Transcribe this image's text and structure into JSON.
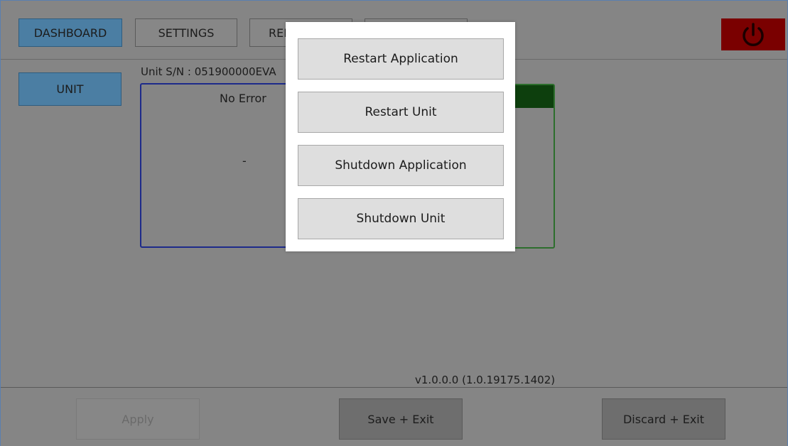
{
  "nav": {
    "tabs": [
      {
        "label": "DASHBOARD",
        "active": true
      },
      {
        "label": "SETTINGS",
        "active": false
      },
      {
        "label": "REF",
        "active": false
      },
      {
        "label": "",
        "active": false
      }
    ]
  },
  "power_icon": "power-icon",
  "sidebar": {
    "unit_label": "UNIT"
  },
  "unit": {
    "serial": "Unit S/N : 051900000EVA"
  },
  "error_panel": {
    "title": "No Error",
    "value": "-"
  },
  "version": "v1.0.0.0 (1.0.19175.1402)",
  "footer": {
    "apply_label": "Apply",
    "save_exit_label": "Save + Exit",
    "discard_exit_label": "Discard + Exit"
  },
  "power_dialog": {
    "options": [
      "Restart Application",
      "Restart Unit",
      "Shutdown Application",
      "Shutdown Unit"
    ]
  },
  "colors": {
    "active_tab": "#4b7ea3",
    "power_button": "#7a0000",
    "error_border": "#1d2a8a",
    "status_border": "#2d6e2d",
    "status_header": "#0d3f0d",
    "dialog_background": "#ffffff"
  }
}
